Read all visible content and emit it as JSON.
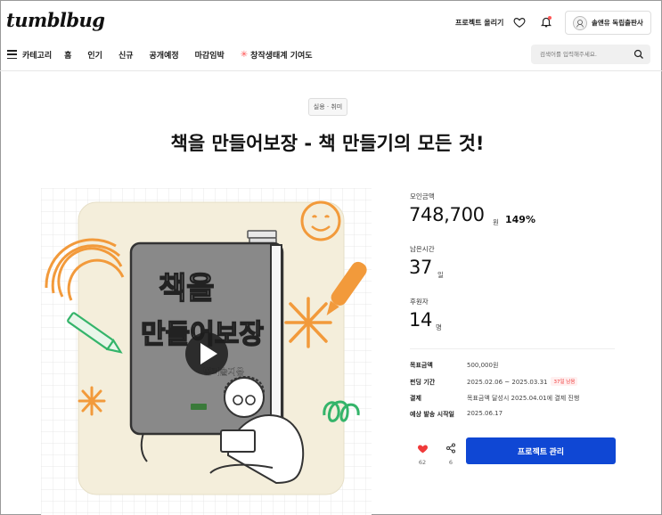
{
  "header": {
    "logo": "tumblbug",
    "create_project": "프로젝트 올리기",
    "user_name": "솔앤유 독립출판사"
  },
  "nav": {
    "categories": "카테고리",
    "items": [
      "홈",
      "인기",
      "신규",
      "공개예정",
      "마감임박"
    ],
    "special": "창작생태계 기여도"
  },
  "search": {
    "placeholder": "검색어를 입력해주세요."
  },
  "project": {
    "category": "실용 · 취미",
    "title": "책을 만들어보장 - 책 만들기의 모든 것!"
  },
  "stats": {
    "amount_label": "모인금액",
    "amount_value": "748,700",
    "amount_unit": "원",
    "percent": "149%",
    "time_label": "남은시간",
    "time_value": "37",
    "time_unit": "일",
    "backers_label": "후원자",
    "backers_value": "14",
    "backers_unit": "명"
  },
  "info": {
    "goal_label": "목표금액",
    "goal_value": "500,000원",
    "period_label": "펀딩 기간",
    "period_value": "2025.02.06 ~ 2025.03.31",
    "days_left_badge": "37일 남음",
    "payment_label": "결제",
    "payment_value": "목표금액 달성시 2025.04.01에 결제 진행",
    "delivery_label": "예상 발송 시작일",
    "delivery_value": "2025.06.17"
  },
  "actions": {
    "like_count": "62",
    "share_count": "6",
    "manage_label": "프로젝트 관리"
  },
  "colors": {
    "accent": "#0f47d4",
    "like": "#f03a3a",
    "orange_doodle": "#f29a3b",
    "green_doodle": "#34b46a"
  },
  "image": {
    "book_title_line1": "책을",
    "book_title_line2": "만들어보장",
    "book_author": "범러솔지음"
  }
}
